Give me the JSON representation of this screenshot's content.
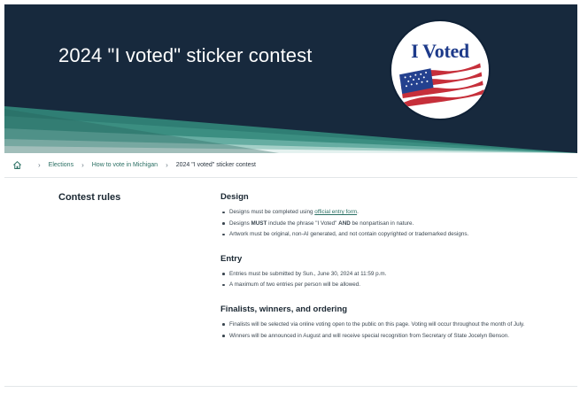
{
  "hero": {
    "title": "2024 \"I voted\" sticker contest",
    "sticker_text": "I Voted",
    "colors": {
      "background": "#17293d",
      "stripe_teal": "#2f7e74",
      "stripe_light": "#6fb3a8"
    }
  },
  "breadcrumb": {
    "home_icon": "home-icon",
    "items": [
      "Elections",
      "How to vote in Michigan"
    ],
    "current": "2024 \"I voted\" sticker contest"
  },
  "sidebar": {
    "title": "Contest rules"
  },
  "sections": {
    "design": {
      "heading": "Design",
      "item1_prefix": "Designs must be completed using ",
      "item1_link": "official entry form",
      "item1_suffix": ".",
      "item2_a": "Designs ",
      "item2_b": "MUST",
      "item2_c": " include the phrase \"I Voted\" ",
      "item2_d": "AND",
      "item2_e": " be nonpartisan in nature.",
      "item3": "Artwork must be original, non-AI generated, and not contain copyrighted or trademarked designs."
    },
    "entry": {
      "heading": "Entry",
      "item1": "Entries must be submitted by Sun., June 30, 2024 at 11:59 p.m.",
      "item2": "A maximum of two entries per person will be allowed."
    },
    "finalists": {
      "heading": "Finalists, winners, and ordering",
      "item1": "Finalists will be selected via online voting open to the public on this page. Voting will occur throughout the month of July.",
      "item2": "Winners will be announced in August and will receive special recognition from Secretary of State Jocelyn Benson."
    }
  }
}
